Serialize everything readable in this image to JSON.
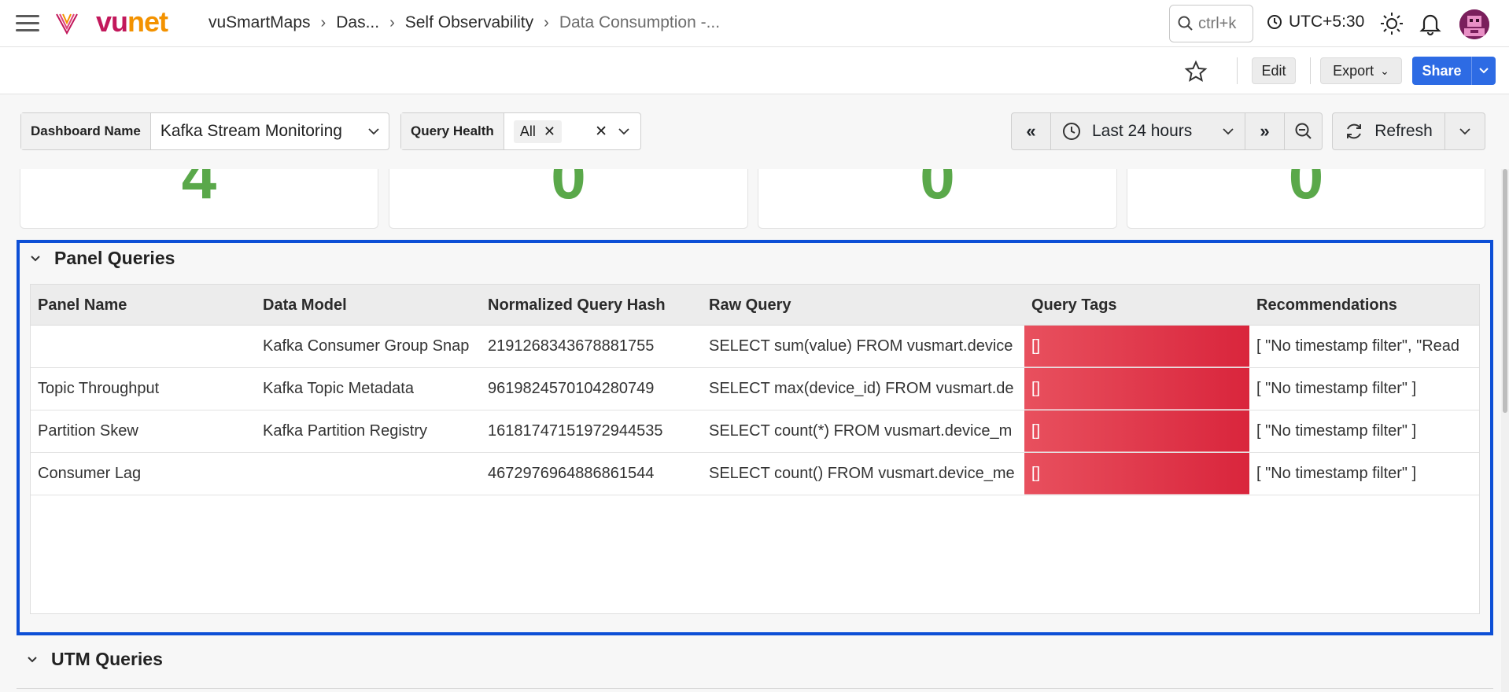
{
  "nav": {
    "logo_vu": "vu",
    "logo_net": "net",
    "breadcrumbs": [
      "vuSmartMaps",
      "Das...",
      "Self Observability",
      "Data Consumption -..."
    ],
    "search_placeholder": "ctrl+k",
    "timezone": "UTC+5:30"
  },
  "toolbar": {
    "edit_label": "Edit",
    "export_label": "Export",
    "share_label": "Share"
  },
  "filters": {
    "dashboard_name_label": "Dashboard Name",
    "dashboard_name_value": "Kafka Stream Monitoring",
    "query_health_label": "Query Health",
    "query_health_chip": "All"
  },
  "time": {
    "range_label": "Last 24 hours",
    "refresh_label": "Refresh"
  },
  "stats": [
    "4",
    "0",
    "0",
    "0"
  ],
  "panel_queries": {
    "title": "Panel Queries",
    "columns": [
      "Panel Name",
      "Data Model",
      "Normalized Query Hash",
      "Raw Query",
      "Query Tags",
      "Recommendations"
    ],
    "rows": [
      [
        "",
        "Kafka Consumer Group Snap",
        "2191268343678881755",
        "SELECT sum(value) FROM vusmart.device",
        "[]",
        "[ \"No timestamp filter\", \"Read"
      ],
      [
        "Topic Throughput",
        "Kafka Topic Metadata",
        "9619824570104280749",
        "SELECT max(device_id) FROM vusmart.de",
        "[]",
        "[ \"No timestamp filter\" ]"
      ],
      [
        "Partition Skew",
        "Kafka Partition Registry",
        "16181747151972944535",
        "SELECT count(*) FROM vusmart.device_m",
        "[]",
        "[ \"No timestamp filter\" ]"
      ],
      [
        "Consumer Lag",
        "",
        "4672976964886861544",
        "SELECT count() FROM vusmart.device_me",
        "[]",
        "[ \"No timestamp filter\" ]"
      ]
    ]
  },
  "utm_queries": {
    "title": "UTM Queries"
  },
  "colors": {
    "accent": "#2d6be4",
    "selection_border": "#0d4fd6",
    "stat_green": "#5aa84a",
    "tag_red": "#d9253c"
  }
}
